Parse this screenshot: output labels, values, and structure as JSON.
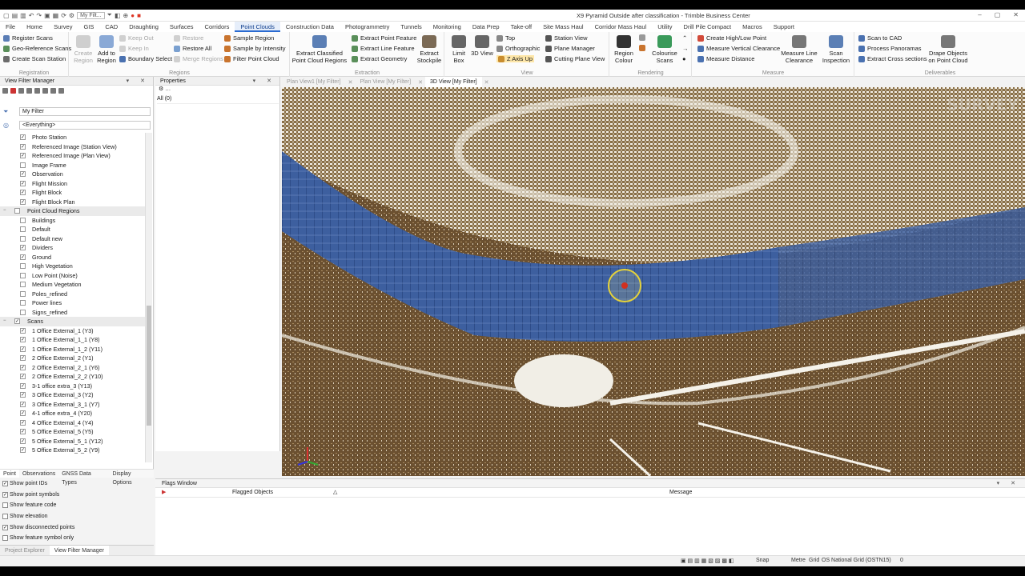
{
  "app": {
    "title": "X9 Pyramid Outside after classification - Trimble Business Center",
    "filter_name": "My Filt..."
  },
  "menu": [
    "File",
    "Home",
    "Survey",
    "GIS",
    "CAD",
    "Draughting",
    "Surfaces",
    "Corridors",
    "Point Clouds",
    "Construction Data",
    "Photogrammetry",
    "Tunnels",
    "Monitoring",
    "Data Prep",
    "Take-off",
    "Site Mass Haul",
    "Corridor Mass Haul",
    "Utility",
    "Drill Pile Compact",
    "Macros",
    "Support"
  ],
  "menu_active": "Point Clouds",
  "ribbon": {
    "registration": {
      "label": "Registration",
      "items": [
        "Register Scans",
        "Geo-Reference Scans",
        "Create Scan Station"
      ]
    },
    "regions": {
      "label": "Regions",
      "create_region": "Create Region",
      "add_to_region": "Add to Region",
      "keep_out": "Keep Out",
      "keep_in": "Keep In",
      "boundary_select": "Boundary Select",
      "restore": "Restore",
      "restore_all": "Restore All",
      "merge_regions": "Merge Regions",
      "sample_region": "Sample Region",
      "sample_by_intensity": "Sample by Intensity",
      "filter_point_cloud": "Filter Point Cloud"
    },
    "extraction": {
      "label": "Extraction",
      "extract_classified": "Extract Classified Point Cloud Regions",
      "extract_point_feature": "Extract Point Feature",
      "extract_line_feature": "Extract Line Feature",
      "extract_geometry": "Extract Geometry",
      "extract_stockpile": "Extract Stockpile"
    },
    "view": {
      "label": "View",
      "limit_box": "Limit Box",
      "view_3d": "3D View",
      "top": "Top",
      "orthographic": "Orthographic",
      "z_axis_up": "Z Axis Up",
      "station_view": "Station View",
      "plane_manager": "Plane Manager",
      "cutting_plane_view": "Cutting Plane View"
    },
    "rendering": {
      "label": "Rendering",
      "region_colour": "Region Colour",
      "colourise_scans": "Colourise Scans"
    },
    "measure": {
      "label": "Measure",
      "create_high_low": "Create High/Low Point",
      "measure_vertical": "Measure Vertical Clearance",
      "measure_distance": "Measure Distance",
      "measure_line_clearance": "Measure Line Clearance",
      "scan_inspection": "Scan Inspection"
    },
    "deliverables": {
      "label": "Deliverables",
      "scan_to_cad": "Scan to CAD",
      "process_panoramas": "Process Panoramas",
      "extract_cross_sections": "Extract Cross sections",
      "drape_objects": "Drape Objects on Point Cloud"
    }
  },
  "view_filter": {
    "panel_title": "View Filter Manager",
    "filter": "My Filter",
    "scope": "<Everything>",
    "tree": [
      {
        "label": "Photo Station",
        "checked": true,
        "section": false
      },
      {
        "label": "Referenced Image (Station View)",
        "checked": true,
        "section": false
      },
      {
        "label": "Referenced Image (Plan View)",
        "checked": true,
        "section": false
      },
      {
        "label": "Image Frame",
        "checked": false,
        "section": false
      },
      {
        "label": "Observation",
        "checked": true,
        "section": false
      },
      {
        "label": "Flight Mission",
        "checked": true,
        "section": false
      },
      {
        "label": "Flight Block",
        "checked": true,
        "section": false
      },
      {
        "label": "Flight Block Plan",
        "checked": true,
        "section": false
      },
      {
        "label": "Point Cloud Regions",
        "checked": false,
        "section": true
      },
      {
        "label": "Buildings",
        "checked": false,
        "section": false
      },
      {
        "label": "Default",
        "checked": false,
        "section": false
      },
      {
        "label": "Default new",
        "checked": false,
        "section": false
      },
      {
        "label": "Dividers",
        "checked": true,
        "section": false
      },
      {
        "label": "Ground",
        "checked": true,
        "section": false
      },
      {
        "label": "High Vegetation",
        "checked": false,
        "section": false
      },
      {
        "label": "Low Point (Noise)",
        "checked": false,
        "section": false
      },
      {
        "label": "Medium Vegetation",
        "checked": false,
        "section": false
      },
      {
        "label": "Poles_refined",
        "checked": false,
        "section": false
      },
      {
        "label": "Power lines",
        "checked": false,
        "section": false
      },
      {
        "label": "Signs_refined",
        "checked": false,
        "section": false
      },
      {
        "label": "Scans",
        "checked": true,
        "section": true
      },
      {
        "label": "1 Office External_1 (Y3)",
        "checked": true,
        "section": false
      },
      {
        "label": "1 Office External_1_1 (Y8)",
        "checked": true,
        "section": false
      },
      {
        "label": "1 Office External_1_2 (Y11)",
        "checked": true,
        "section": false
      },
      {
        "label": "2 Office External_2 (Y1)",
        "checked": true,
        "section": false
      },
      {
        "label": "2 Office External_2_1 (Y6)",
        "checked": true,
        "section": false
      },
      {
        "label": "2 Office External_2_2 (Y10)",
        "checked": true,
        "section": false
      },
      {
        "label": "3-1 office extra_3 (Y13)",
        "checked": true,
        "section": false
      },
      {
        "label": "3 Office External_3 (Y2)",
        "checked": true,
        "section": false
      },
      {
        "label": "3 Office External_3_1 (Y7)",
        "checked": true,
        "section": false
      },
      {
        "label": "4-1 office extra_4 (Y20)",
        "checked": true,
        "section": false
      },
      {
        "label": "4 Office External_4 (Y4)",
        "checked": true,
        "section": false
      },
      {
        "label": "5 Office External_5 (Y5)",
        "checked": true,
        "section": false
      },
      {
        "label": "5 Office External_5_1 (Y12)",
        "checked": true,
        "section": false
      },
      {
        "label": "5 Office External_5_2 (Y9)",
        "checked": true,
        "section": false
      }
    ],
    "tabs": [
      "Point",
      "Observations",
      "GNSS Data Types",
      "Display Options"
    ],
    "options": [
      {
        "label": "Show point IDs",
        "checked": true
      },
      {
        "label": "Show point symbols",
        "checked": true
      },
      {
        "label": "Show feature code",
        "checked": false
      },
      {
        "label": "Show elevation",
        "checked": false
      },
      {
        "label": "Show disconnected points",
        "checked": true
      },
      {
        "label": "Show feature symbol only",
        "checked": false
      }
    ],
    "bottom_tabs": [
      "Project Explorer",
      "View Filter Manager"
    ]
  },
  "properties": {
    "title": "Properties",
    "selection": "All (0)"
  },
  "view_tabs": [
    "Plan View1 [My Filter]",
    "Plan View [My Filter]",
    "3D View [My Filter]"
  ],
  "flags": {
    "title": "Flags Window",
    "col_objects": "Flagged Objects",
    "col_message": "Message"
  },
  "status": {
    "snap": "Snap",
    "units": "Metre",
    "grid": "Grid",
    "crs": "OS National Grid (OSTN15)",
    "count": "0"
  },
  "watermark": "SURVEY"
}
